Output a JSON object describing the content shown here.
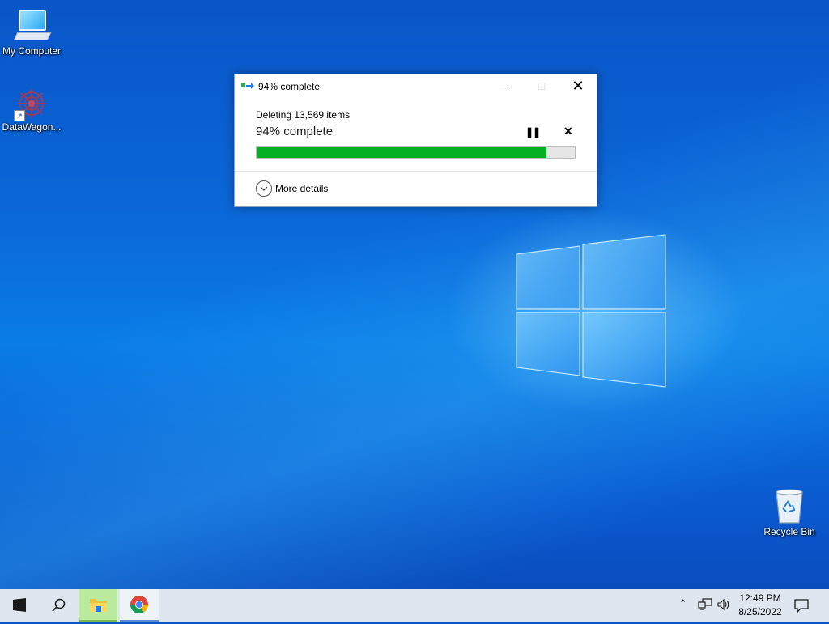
{
  "desktop": {
    "icons": [
      {
        "label": "My Computer",
        "icon": "computer-icon"
      },
      {
        "label": "DataWagon...",
        "icon": "datawagon-app-icon"
      },
      {
        "label": "Recycle Bin",
        "icon": "recycle-bin-icon"
      }
    ]
  },
  "dialog": {
    "title": "94% complete",
    "description": "Deleting 13,569 items",
    "percent_text": "94% complete",
    "progress": 0.91,
    "more_details": "More details",
    "progress_color": "#06b025",
    "controls": {
      "minimize": "minimize-icon",
      "maximize": "maximize-icon",
      "close": "close-icon",
      "pause": "pause-icon",
      "cancel": "cancel-icon"
    }
  },
  "taskbar": {
    "apps": [
      {
        "name": "start",
        "icon": "windows-start-icon"
      },
      {
        "name": "search",
        "icon": "search-icon"
      },
      {
        "name": "File Explorer",
        "icon": "folder-icon",
        "active": true
      },
      {
        "name": "Google Chrome",
        "icon": "chrome-icon",
        "active": false
      }
    ],
    "clock": {
      "time": "12:49 PM",
      "date": "8/25/2022"
    }
  }
}
